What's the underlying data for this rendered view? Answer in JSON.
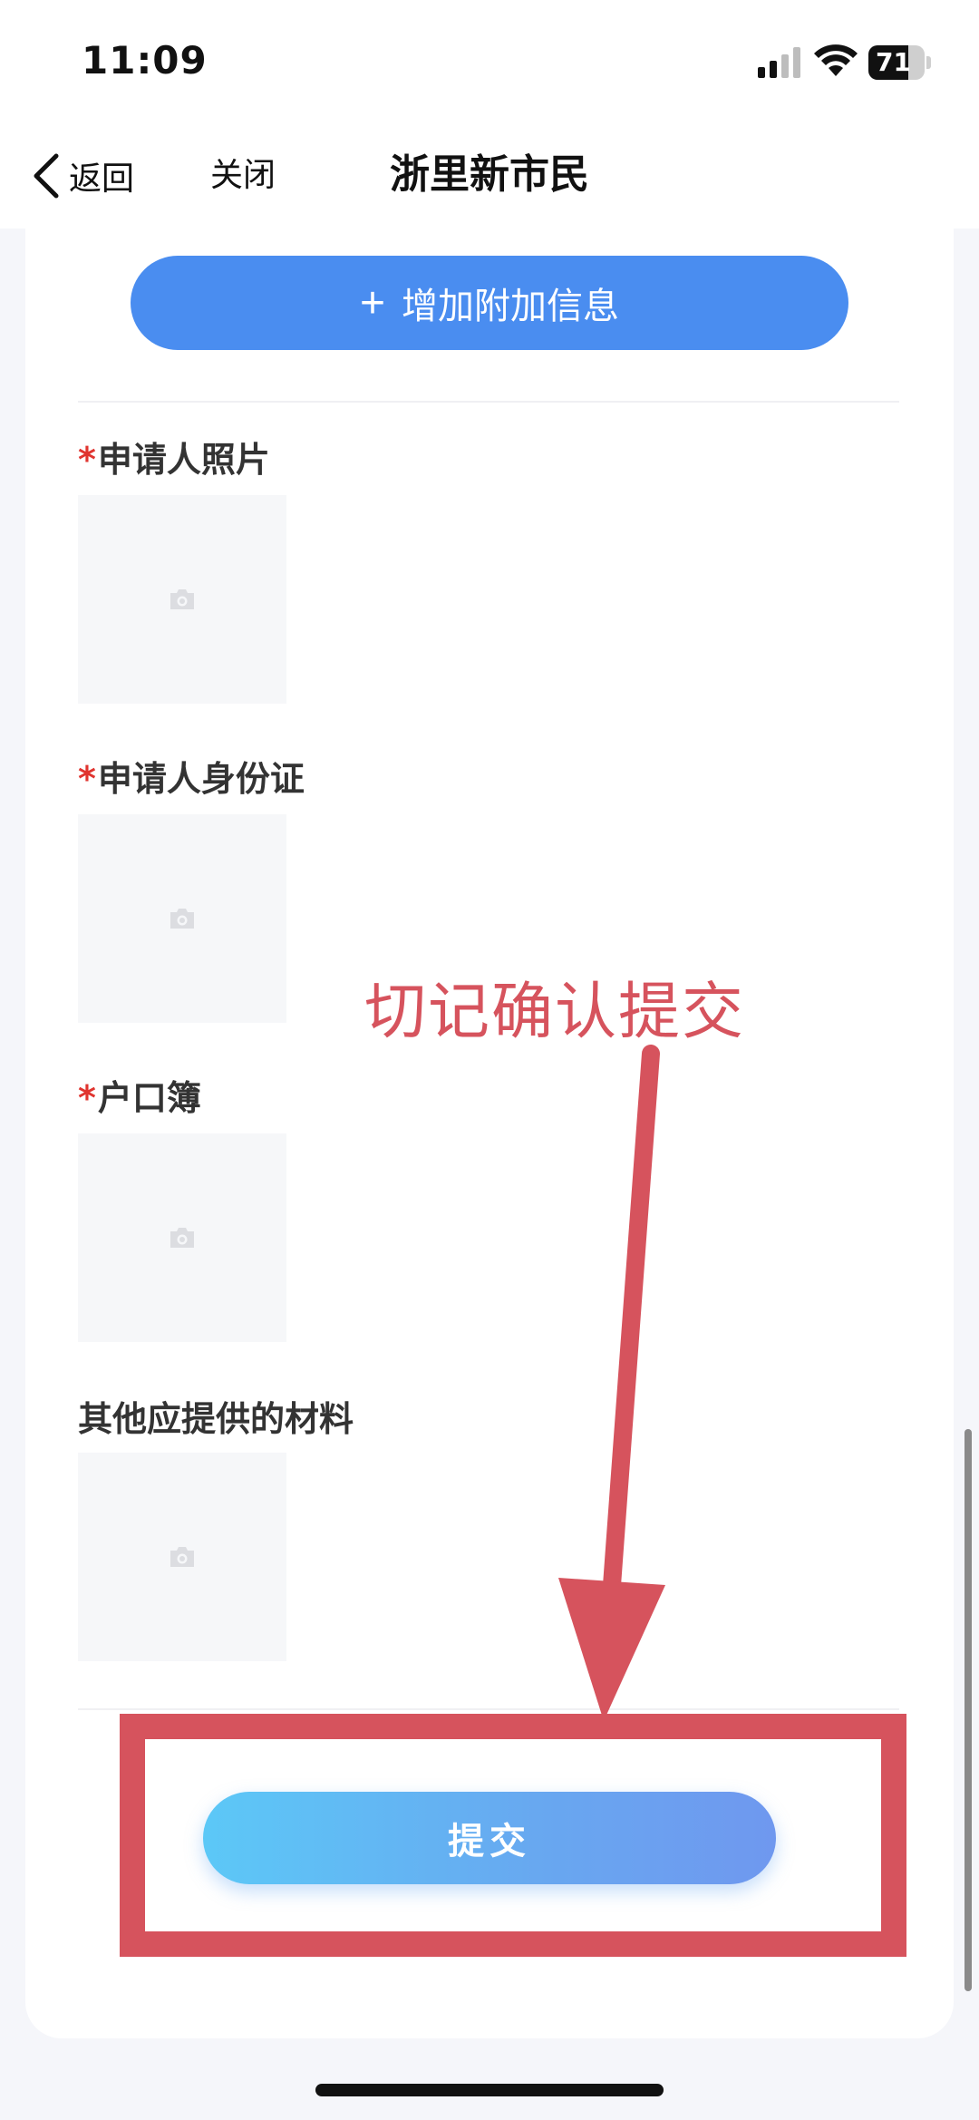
{
  "status_bar": {
    "time": "11:09",
    "battery_level": "71",
    "battery_fraction": 0.71
  },
  "nav": {
    "back_label": "返回",
    "close_label": "关闭",
    "title": "浙里新市民"
  },
  "form": {
    "add_info_label": "增加附加信息",
    "upload_fields": [
      {
        "label": "申请人照片",
        "required": true
      },
      {
        "label": "申请人身份证",
        "required": true
      },
      {
        "label": "户口簿",
        "required": true
      },
      {
        "label": "其他应提供的材料",
        "required": false
      }
    ],
    "required_mark": "*",
    "submit_label": "提交"
  },
  "annotation": {
    "text": "切记确认提交",
    "color": "#d6535d"
  },
  "colors": {
    "accent": "#4a8df0",
    "required": "#e0342f"
  },
  "icons": {
    "back": "chevron-left-icon",
    "plus": "plus-icon",
    "upload": "camera-icon"
  }
}
